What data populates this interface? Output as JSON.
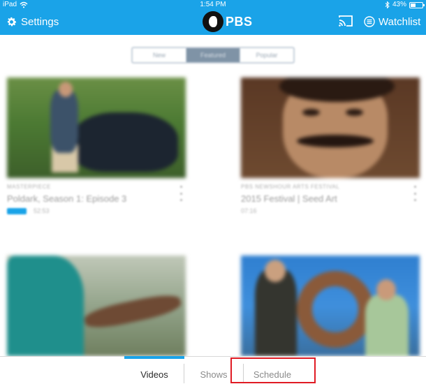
{
  "status_bar": {
    "carrier": "iPad",
    "time": "1:54 PM",
    "battery": "43%"
  },
  "navbar": {
    "settings_label": "Settings",
    "logo_text": "PBS",
    "watchlist_label": "Watchlist",
    "icons": [
      "gear-icon",
      "wifi-icon",
      "bluetooth-icon",
      "battery-icon",
      "cast-icon",
      "watchlist-icon"
    ],
    "accent_color": "#1aa3e8"
  },
  "segmented": {
    "items": [
      "New",
      "Featured",
      "Popular"
    ],
    "selected": "Featured"
  },
  "cards": [
    {
      "show": "MASTERPIECE",
      "title": "Poldark, Season 1: Episode 3",
      "duration": "52:53",
      "has_badge": true
    },
    {
      "show": "PBS NEWSHOUR ARTS FESTIVAL",
      "title": "2015 Festival | Seed Art",
      "duration": "07:16",
      "has_badge": false
    },
    {
      "show": "",
      "title": "",
      "duration": "",
      "has_badge": false
    },
    {
      "show": "",
      "title": "",
      "duration": "",
      "has_badge": false
    }
  ],
  "tabs": [
    {
      "label": "Videos",
      "active": true
    },
    {
      "label": "Shows",
      "active": false
    },
    {
      "label": "Schedule",
      "active": false
    }
  ],
  "annotation": {
    "highlighted_tab": "Schedule",
    "color": "#e01b24"
  }
}
